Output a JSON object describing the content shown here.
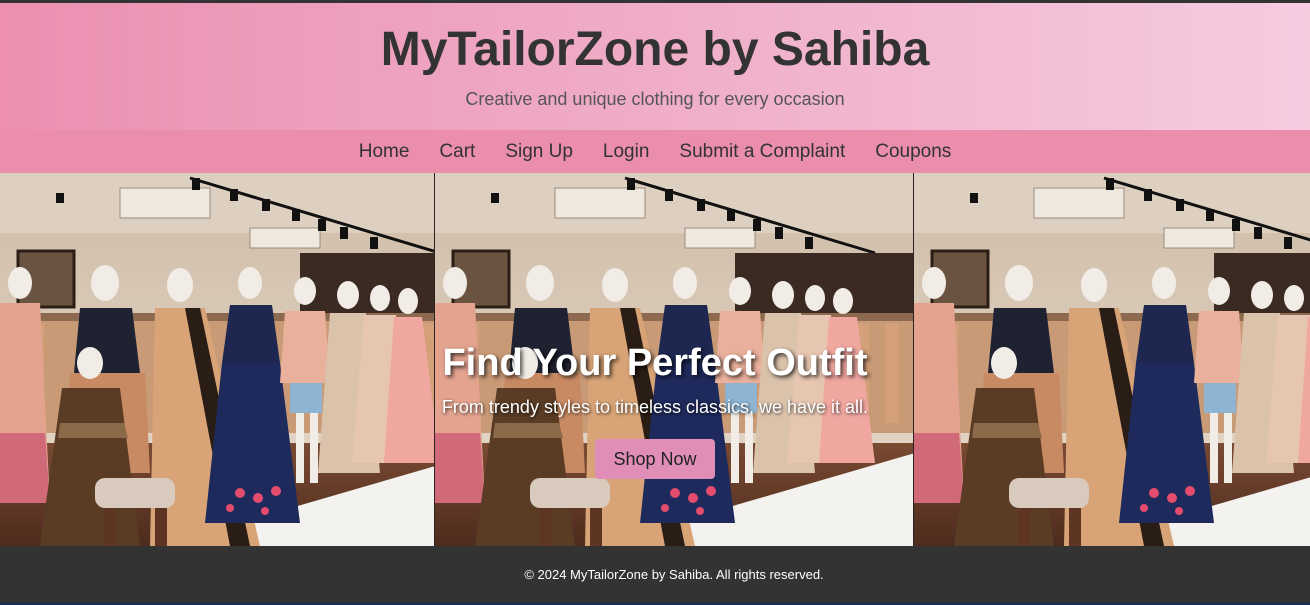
{
  "header": {
    "title": "MyTailorZone by Sahiba",
    "tagline": "Creative and unique clothing for every occasion"
  },
  "nav": {
    "items": [
      "Home",
      "Cart",
      "Sign Up",
      "Login",
      "Submit a Complaint",
      "Coupons"
    ]
  },
  "hero": {
    "title": "Find Your Perfect Outfit",
    "subtitle": "From trendy styles to timeless classics, we have it all.",
    "button_label": "Shop Now",
    "image_icon": "boutique-mannequins-photo"
  },
  "footer": {
    "text": "© 2024 MyTailorZone by Sahiba. All rights reserved."
  },
  "colors": {
    "header_start": "#ec8fb1",
    "header_end": "#f6cbe0",
    "nav_bg": "#ea8eab",
    "button_bg": "#e08eb8",
    "footer_bg": "#333333"
  }
}
